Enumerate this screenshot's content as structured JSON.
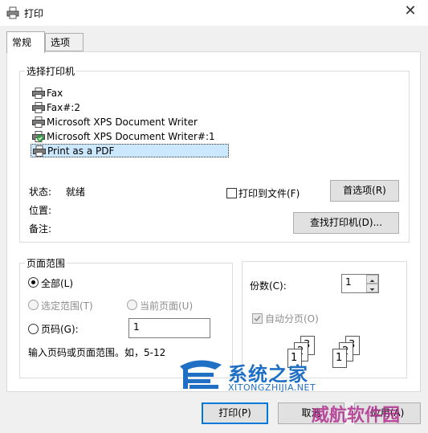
{
  "window": {
    "title": "打印",
    "close_glyph": "✕"
  },
  "tabs": [
    {
      "label": "常规",
      "active": true
    },
    {
      "label": "选项",
      "active": false
    }
  ],
  "select_printer": {
    "legend": "选择打印机",
    "printers": [
      {
        "name": "Fax",
        "icon": "printer-icon",
        "selected": false
      },
      {
        "name": "Fax#:2",
        "icon": "printer-icon",
        "selected": false
      },
      {
        "name": "Microsoft XPS Document Writer",
        "icon": "printer-icon",
        "selected": false
      },
      {
        "name": "Microsoft XPS Document Writer#:1",
        "icon": "default-printer-icon",
        "selected": false
      },
      {
        "name": "Print as a PDF",
        "icon": "printer-icon",
        "selected": true
      }
    ],
    "status_label": "状态:",
    "status_value": "就绪",
    "location_label": "位置:",
    "comment_label": "备注:",
    "print_to_file": {
      "label": "打印到文件(F)",
      "checked": false
    },
    "preferences_button": "首选项(R)",
    "find_printer_button": "查找打印机(D)..."
  },
  "page_range": {
    "legend": "页面范围",
    "all": {
      "label": "全部(L)",
      "checked": true
    },
    "selection": {
      "label": "选定范围(T)",
      "enabled": false
    },
    "current_page": {
      "label": "当前页面(U)",
      "enabled": false
    },
    "pages": {
      "label": "页码(G):",
      "value": "1"
    },
    "hint": "输入页码或页面范围。如，5-12"
  },
  "copies": {
    "label": "份数(C):",
    "value": "1",
    "collate": {
      "label": "自动分页(O)",
      "checked": true,
      "enabled": false
    },
    "collate_icon": "collate-pages-icon",
    "page_numbers": [
      "1",
      "2",
      "3"
    ]
  },
  "buttons": {
    "print": "打印(P)",
    "cancel": "取消",
    "apply": "应用(A)"
  },
  "watermark": {
    "site_name": "系统之家",
    "site_url": "XITONGZHIJIA.NET",
    "overlay_text": "威航软件园"
  },
  "colors": {
    "accent": "#0078d7",
    "selection_bg": "#cce8ff",
    "watermark_blue": "#1f6fc4",
    "overlay_purple": "#b0308f"
  }
}
